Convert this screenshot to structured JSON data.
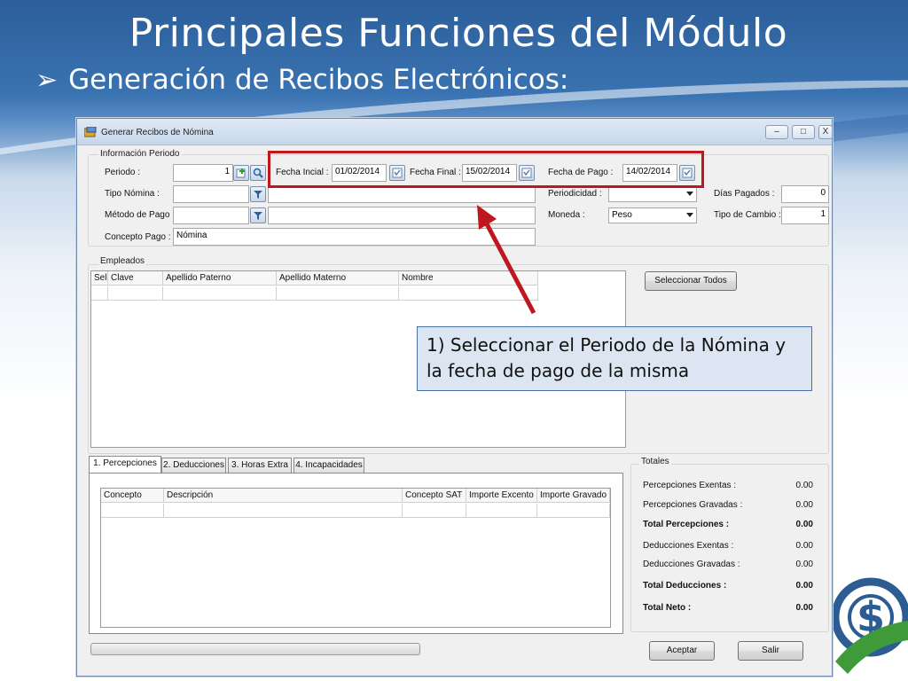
{
  "slide": {
    "title": "Principales Funciones del Módulo",
    "subtitle": "Generación de Recibos Electrónicos:",
    "bullet": "➢"
  },
  "window": {
    "title": "Generar Recibos de Nómina",
    "minimize": "–",
    "maximize": "□",
    "close": "X"
  },
  "info_periodo": {
    "legend": "Información Periodo",
    "periodo_label": "Periodo :",
    "periodo_value": "1",
    "fecha_inicial_label": "Fecha Incial :",
    "fecha_inicial_value": "01/02/2014",
    "fecha_final_label": "Fecha Final :",
    "fecha_final_value": "15/02/2014",
    "fecha_pago_label": "Fecha de Pago :",
    "fecha_pago_value": "14/02/2014",
    "tipo_nomina_label": "Tipo Nómina :",
    "tipo_nomina_value": "",
    "periodicidad_label": "Periodicidad :",
    "periodicidad_value": "",
    "dias_pagados_label": "Días Pagados :",
    "dias_pagados_value": "0",
    "metodo_pago_label": "Método de Pago :",
    "metodo_pago_value": "",
    "moneda_label": "Moneda :",
    "moneda_value": "Peso",
    "tipo_cambio_label": "Tipo de Cambio :",
    "tipo_cambio_value": "1",
    "concepto_pago_label": "Concepto Pago :",
    "concepto_pago_value": "Nómina"
  },
  "empleados": {
    "legend": "Empleados",
    "columns": [
      "Sel",
      "Clave",
      "Apellido Paterno",
      "Apellido Materno",
      "Nombre"
    ],
    "select_all_label": "Seleccionar Todos"
  },
  "tabs": [
    {
      "label": "1. Percepciones",
      "active": true
    },
    {
      "label": "2. Deducciones",
      "active": false
    },
    {
      "label": "3. Horas Extra",
      "active": false
    },
    {
      "label": "4. Incapacidades",
      "active": false
    }
  ],
  "percepciones": {
    "columns": [
      "Concepto",
      "Descripción",
      "Concepto SAT",
      "Importe Excento",
      "Importe Gravado"
    ]
  },
  "totales": {
    "legend": "Totales",
    "rows": [
      {
        "label": "Percepciones Exentas :",
        "value": "0.00",
        "bold": false
      },
      {
        "label": "Percepciones Gravadas :",
        "value": "0.00",
        "bold": false
      },
      {
        "label": "Total Percepciones :",
        "value": "0.00",
        "bold": true
      },
      {
        "label": "Deducciones Exentas :",
        "value": "0.00",
        "bold": false
      },
      {
        "label": "Deducciones Gravadas :",
        "value": "0.00",
        "bold": false
      },
      {
        "label": "Total Deducciones :",
        "value": "0.00",
        "bold": true
      },
      {
        "label": "Total Neto :",
        "value": "0.00",
        "bold": true
      }
    ]
  },
  "buttons": {
    "aceptar": "Aceptar",
    "salir": "Salir"
  },
  "annotation": {
    "callout_line1": "1) Seleccionar el Periodo de la Nómina y",
    "callout_line2": "la fecha de pago de la misma"
  },
  "colors": {
    "highlight": "#c0161f",
    "callout_bg": "#dce6f2",
    "slide_blue": "#2c5f9a"
  }
}
